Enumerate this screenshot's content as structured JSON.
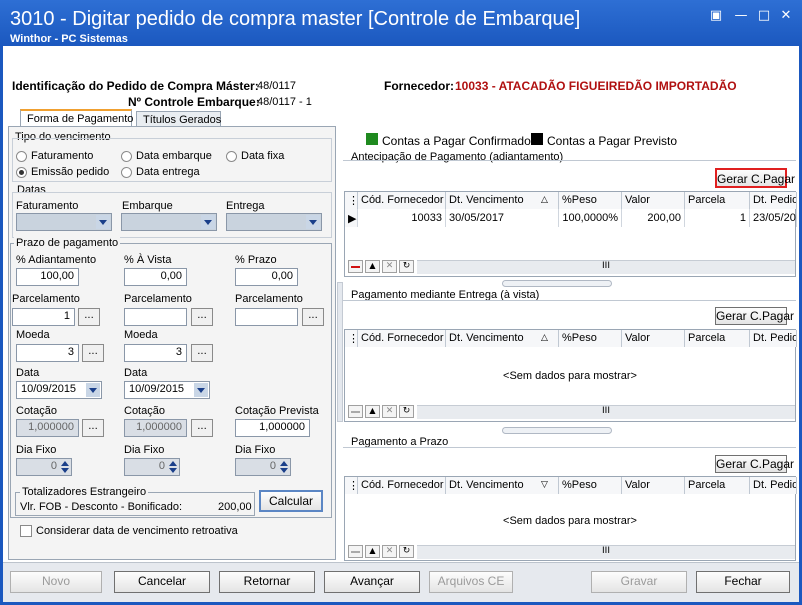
{
  "window": {
    "title": "3010 - Digitar pedido de compra master [Controle de Embarque]",
    "subtitle": "Winthor - PC Sistemas"
  },
  "header": {
    "id_label": "Identificação do Pedido de Compra Máster:",
    "id_value": "48/0117",
    "control_label": "Nº Controle Embarque:",
    "control_value": "48/0117 - 1",
    "supplier_label": "Fornecedor:",
    "supplier_value": "10033 - ATACADÃO FIGUEIREDÃO IMPORTADÃO"
  },
  "tabs": [
    {
      "label": "Forma de Pagamento",
      "active": true
    },
    {
      "label": "Títulos Gerados",
      "active": false
    }
  ],
  "left": {
    "vencimento_title": "Tipo do vencimento",
    "radios": [
      "Faturamento",
      "Data embarque",
      "Data fixa",
      "Emissão pedido",
      "Data entrega"
    ],
    "radio_selected": "Emissão pedido",
    "datas_title": "Datas",
    "datas_labels": [
      "Faturamento",
      "Embarque",
      "Entrega"
    ],
    "prazo_title": "Prazo de pagamento",
    "pct_labels": [
      "% Adiantamento",
      "% À Vista",
      "% Prazo"
    ],
    "pct_values": [
      "100,00",
      "0,00",
      "0,00"
    ],
    "parcel_label": "Parcelamento",
    "parcel_values": [
      "1",
      "",
      ""
    ],
    "moeda_label": "Moeda",
    "moeda_values": [
      "3",
      "3"
    ],
    "data_label": "Data",
    "data_values": [
      "10/09/2015",
      "10/09/2015"
    ],
    "cotacao_labels": [
      "Cotação",
      "Cotação",
      "Cotação Prevista"
    ],
    "cotacao_values": [
      "1,000000",
      "1,000000",
      "1,000000"
    ],
    "diafixo_label": "Dia Fixo",
    "diafixo_values": [
      "0",
      "0",
      "0"
    ],
    "totalizadores_title": "Totalizadores Estrangeiro",
    "totalizadores_label": "Vlr. FOB - Desconto - Bonificado:",
    "totalizadores_value": "200,00",
    "calcular_label": "Calcular",
    "retroativa_label": "Considerar data de vencimento retroativa"
  },
  "legend": {
    "confirmed_label": "Contas a Pagar Confirmado",
    "confirmed_color": "#1f8a1f",
    "forecast_label": "Contas a Pagar Previsto",
    "forecast_color": "#000000"
  },
  "grids": {
    "headers": [
      "Cód. Fornecedor",
      "Dt. Vencimento",
      "%Peso",
      "Valor",
      "Parcela",
      "Dt. Pedido"
    ],
    "gerar_label": "Gerar C.Pagar",
    "empty_text": "<Sem dados para mostrar>",
    "antecipacao_title": "Antecipação de Pagamento (adiantamento)",
    "antecipacao_row": [
      "10033",
      "30/05/2017",
      "100,0000%",
      "200,00",
      "1",
      "23/05/20"
    ],
    "entrega_title": "Pagamento mediante Entrega (à vista)",
    "prazo_title": "Pagamento a Prazo",
    "scroll_label": "III"
  },
  "footer": {
    "buttons": [
      "Novo",
      "Cancelar",
      "Retornar",
      "Avançar",
      "Arquivos CE",
      "Gravar",
      "Fechar"
    ]
  }
}
